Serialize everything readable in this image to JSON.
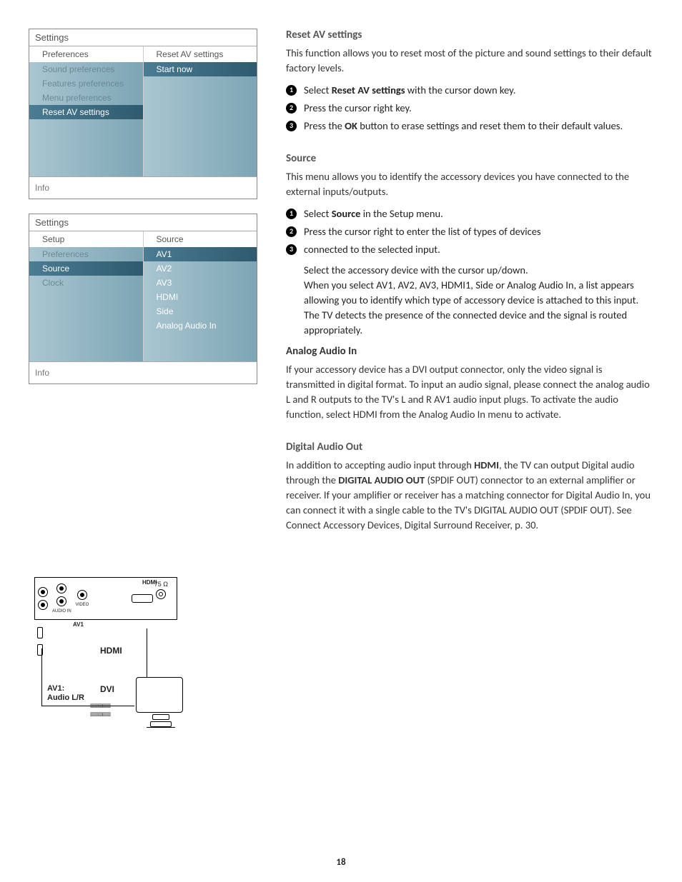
{
  "panel1": {
    "title": "Settings",
    "leftHead": "Preferences",
    "rightHead": "Reset AV settings",
    "leftItems": [
      "Sound preferences",
      "Features preferences",
      "Menu preferences",
      "Reset AV settings",
      "",
      "",
      "",
      ""
    ],
    "leftSelected": 3,
    "rightItems": [
      "Start now",
      "",
      "",
      "",
      "",
      "",
      "",
      ""
    ],
    "rightSelected": 0,
    "footer": "Info"
  },
  "panel2": {
    "title": "Settings",
    "leftHead": "Setup",
    "rightHead": "Source",
    "leftItems": [
      "Preferences",
      "Source",
      "Clock",
      "",
      "",
      "",
      "",
      ""
    ],
    "leftSelected": 1,
    "rightItems": [
      "AV1",
      "AV2",
      "AV3",
      "HDMI",
      "Side",
      "Analog Audio In",
      "",
      ""
    ],
    "rightSelected": 0,
    "footer": "Info"
  },
  "diagram": {
    "ohm": "75 Ω",
    "av1": "AV1",
    "hdmiPort": "HDMI",
    "hdmi": "HDMI",
    "dvi": "DVI",
    "av": "AV1:\nAudio L/R"
  },
  "sections": {
    "reset": {
      "title": "Reset AV settings",
      "intro": "This function allows you to reset most of the picture and sound settings to their default factory levels.",
      "step1a": "Select ",
      "step1b": "Reset AV settings",
      "step1c": " with the cursor down key.",
      "step2": "Press the cursor right key.",
      "step3a": "Press the ",
      "step3b": "OK",
      "step3c": " button to erase settings and reset them to their default values."
    },
    "source": {
      "title": "Source",
      "intro": "This menu allows you to identify the accessory devices you have connected to the external inputs/outputs.",
      "step1a": "Select ",
      "step1b": "Source",
      "step1c": " in the Setup menu.",
      "step2": "Press the cursor right to enter the list of types of devices",
      "step3": "connected to the selected input.",
      "tail1": "Select the accessory device with the cursor up/down.",
      "tail2": "When you select AV1, AV2, AV3, HDMI1, Side or Analog Audio In, a list appears allowing you to identify which type of accessory device is attached to this input. The TV detects the presence of the connected device and the signal is routed appropriately."
    },
    "analog": {
      "title": "Analog Audio In",
      "body": "If your accessory device has a DVI output connector, only the video signal is transmitted in digital format.  To input an audio signal, please connect the analog audio L and R outputs to the TV's L and R AV1 audio input plugs.  To activate the audio function, select  HDMI from the Analog Audio In menu to activate."
    },
    "digital": {
      "title": "Digital Audio Out",
      "p1a": "In addition to accepting audio input through ",
      "p1b": "HDMI",
      "p1c": ", the TV can output Digital audio through the ",
      "p1d": "DIGITAL AUDIO OUT",
      "p1e": " (SPDIF OUT) connector to an external amplifier or receiver. If your amplifier or receiver has a matching connector for Digital Audio In, you can connect it with a single cable to the TV's DIGITAL AUDIO OUT (SPDIF OUT). See Connect Accessory Devices, Digital Surround Receiver, p. 30."
    }
  },
  "pageNumber": "18"
}
